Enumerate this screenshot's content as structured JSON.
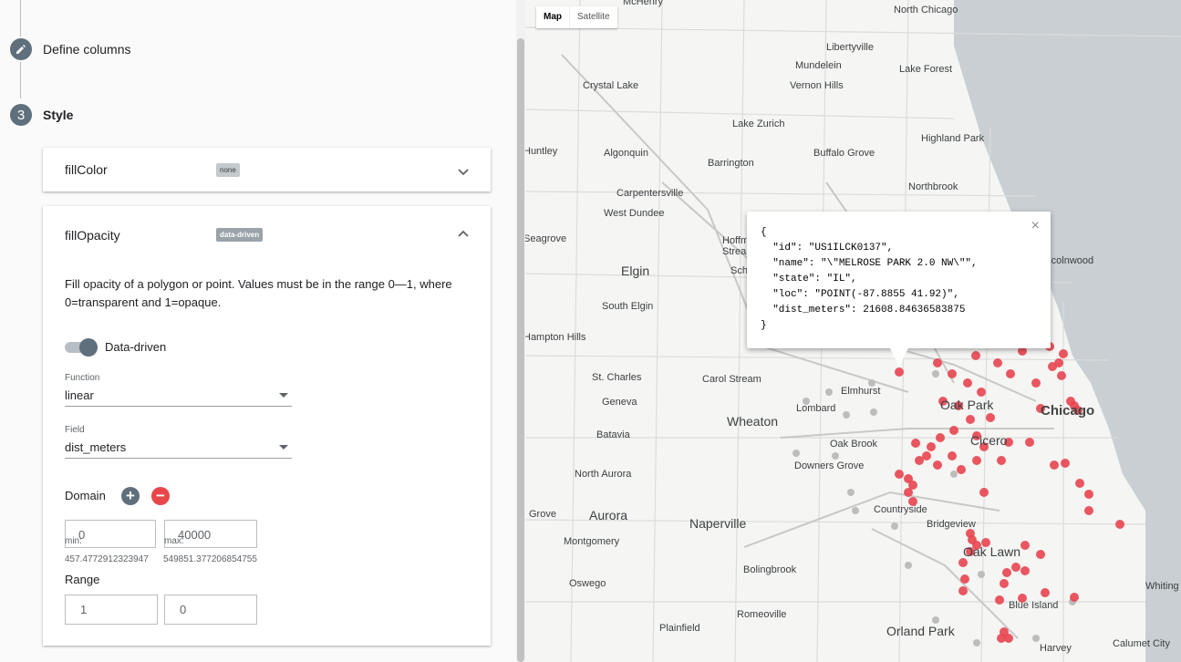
{
  "stepper": {
    "define_columns": "Define columns",
    "style_number": "3",
    "style_label": "Style"
  },
  "fill_color": {
    "title": "fillColor",
    "badge": "none"
  },
  "fill_opacity": {
    "title": "fillOpacity",
    "badge": "data-driven",
    "description": "Fill opacity of a polygon or point. Values must be in the range 0—1, where 0=transparent and 1=opaque.",
    "toggle_label": "Data-driven",
    "function_label": "Function",
    "function_value": "linear",
    "field_label": "Field",
    "field_value": "dist_meters",
    "domain_label": "Domain",
    "domain_min": "0",
    "domain_max": "40000",
    "min_label": "min:",
    "max_label": "max:",
    "min_value": "457.4772912323947",
    "max_value": "549851.377206854755",
    "range_label": "Range",
    "range_min": "1",
    "range_max": "0"
  },
  "map": {
    "type_map": "Map",
    "type_satellite": "Satellite",
    "places": [
      "McHenry",
      "North Chicago",
      "Libertyville",
      "Mundelein",
      "Lake Forest",
      "Crystal Lake",
      "Vernon Hills",
      "Lake Zurich",
      "Highland Park",
      "Huntley",
      "Algonquin",
      "Buffalo Grove",
      "Barrington",
      "Northbrook",
      "Carpentersville",
      "West Dundee",
      "Hoffman Estates",
      "Schaumburg",
      "Elgin",
      "South Elgin",
      "Streamwood",
      "Hampton Hills",
      "St. Charles",
      "Carol Stream",
      "Elmhurst",
      "Oak Park",
      "Geneva",
      "Lombard",
      "Chicago",
      "Wheaton",
      "Batavia",
      "Oak Brook",
      "Cicero",
      "North Aurora",
      "Downers Grove",
      "Countryside",
      "Aurora",
      "Naperville",
      "Bridgeview",
      "Montgomery",
      "Oak Lawn",
      "Bolingbrook",
      "Oswego",
      "Blue Island",
      "Whiting",
      "Romeoville",
      "Plainfield",
      "Orland Park",
      "Calumet City",
      "Harvey",
      "Seagrove",
      "Grove",
      "Lincolnwood"
    ]
  },
  "popup": {
    "json": "{\n  \"id\": \"US1ILCK0137\",\n  \"name\": \"\\\"MELROSE PARK 2.0 NW\\\"\",\n  \"state\": \"IL\",\n  \"loc\": \"POINT(-87.8855 41.92)\",\n  \"dist_meters\": 21608.84636583875\n}",
    "close": "×"
  },
  "colors": {
    "accent": "#5f6f7c",
    "add": "#5f6f7c",
    "remove": "#e8474a",
    "point": "#e84550",
    "lake": "#c9cfd2"
  }
}
